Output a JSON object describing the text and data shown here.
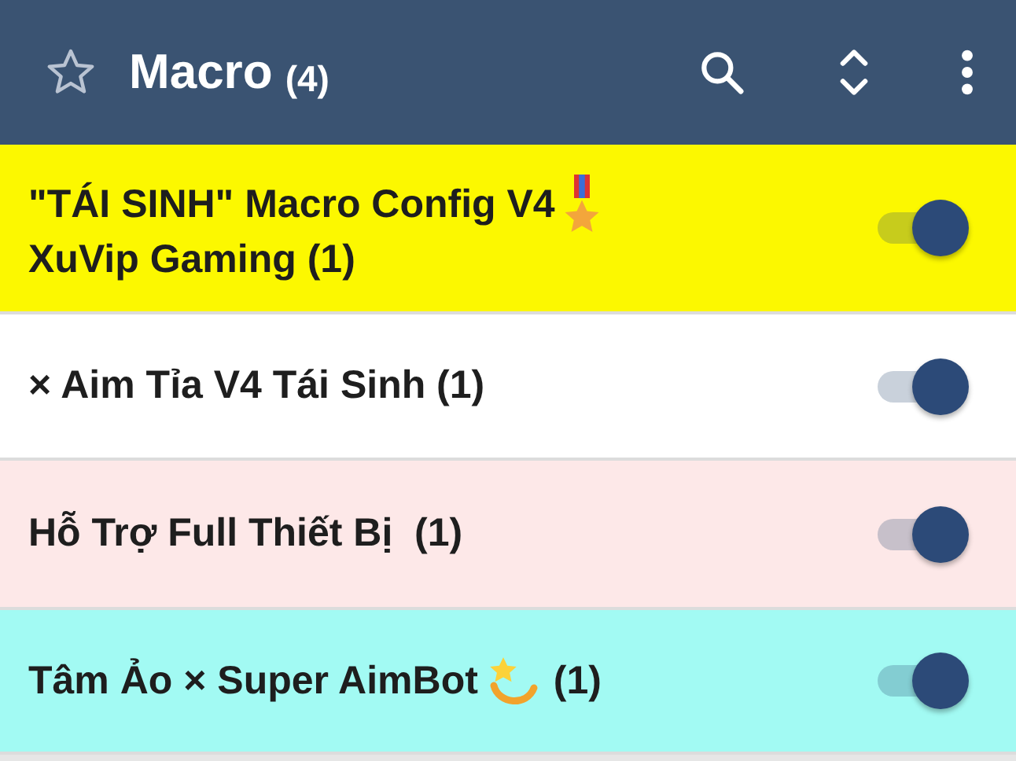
{
  "header": {
    "title": "Macro",
    "count": "(4)"
  },
  "macros": [
    {
      "text": "\"TÁI SINH\" Macro Config V4",
      "kind": "medal",
      "after": "XuVip Gaming (1)",
      "color": "#fcf800",
      "on": true
    },
    {
      "text": "× Aim Tỉa V4 Tái Sinh (1)",
      "kind": "plain",
      "color": "#ffffff",
      "on": true
    },
    {
      "text": "Hỗ Trợ Full Thiết Bị  (1)",
      "kind": "plain",
      "color": "#fde8e8",
      "on": true
    },
    {
      "text": "Tâm Ảo × Super AimBot",
      "kind": "sparkle",
      "after": "(1)",
      "color": "#a2faf3",
      "on": true
    }
  ]
}
